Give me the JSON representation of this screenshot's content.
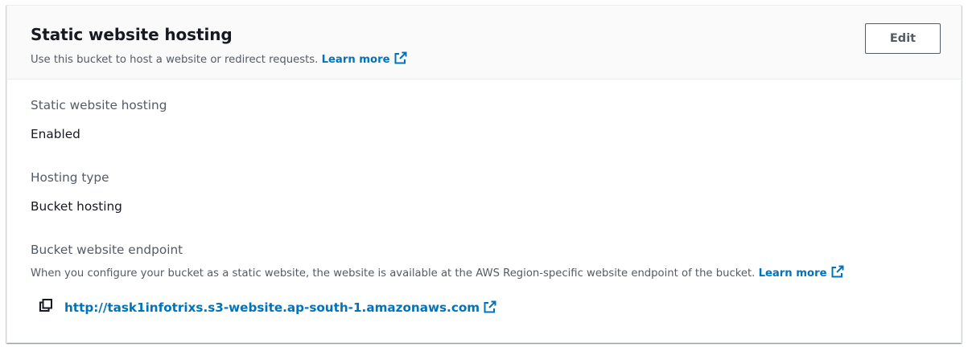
{
  "panel": {
    "title": "Static website hosting",
    "description": "Use this bucket to host a website or redirect requests.",
    "learn_more": "Learn more",
    "edit_label": "Edit"
  },
  "fields": {
    "hosting": {
      "label": "Static website hosting",
      "value": "Enabled"
    },
    "hosting_type": {
      "label": "Hosting type",
      "value": "Bucket hosting"
    },
    "endpoint": {
      "label": "Bucket website endpoint",
      "description": "When you configure your bucket as a static website, the website is available at the AWS Region-specific website endpoint of the bucket.",
      "learn_more": "Learn more",
      "url": "http://task1infotrixs.s3-website.ap-south-1.amazonaws.com"
    }
  },
  "colors": {
    "link": "#0073bb",
    "text_primary": "#16191f",
    "text_secondary": "#545b64",
    "header_bg": "#fafafa"
  },
  "icons": {
    "external_link": "external-link-icon",
    "copy": "copy-icon"
  }
}
